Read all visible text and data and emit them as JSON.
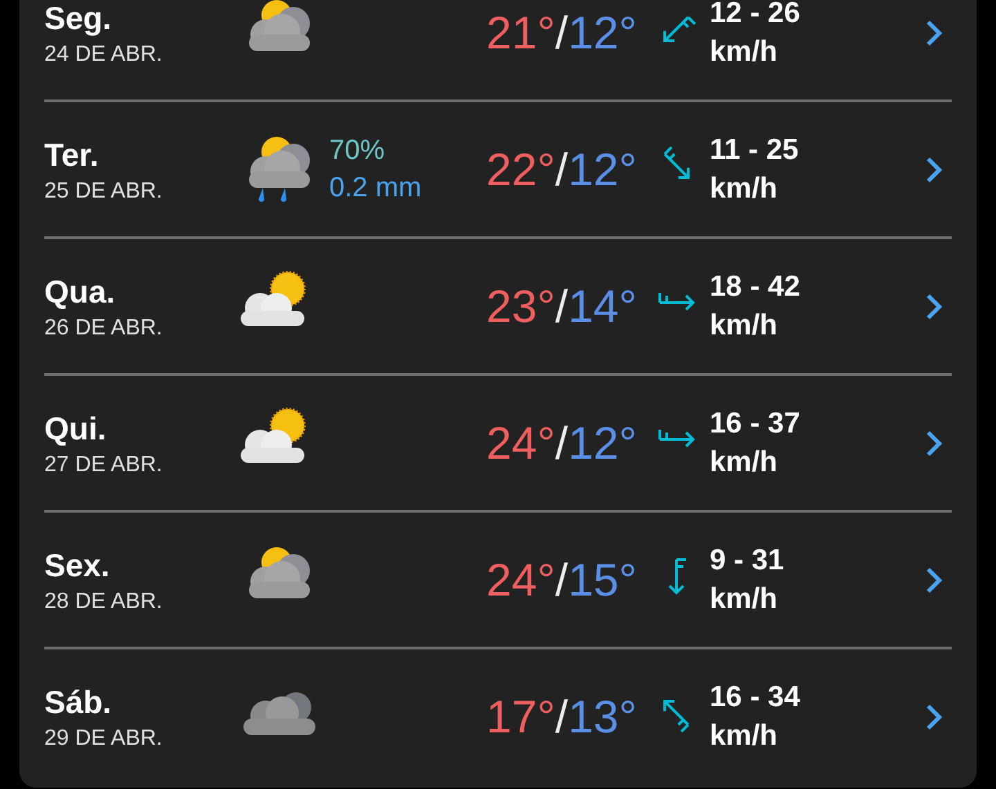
{
  "days": [
    {
      "day": "Seg.",
      "date": "24 DE ABR.",
      "kind": "partly_cloudy_grey",
      "high": "21°",
      "separator": "/",
      "low": "12°",
      "wind": {
        "kind": "sw",
        "speed": "12 - 26",
        "unit": "km/h"
      }
    },
    {
      "day": "Ter.",
      "date": "25 DE ABR.",
      "kind": "rain",
      "rain_chance": "70%",
      "rain_amount": "0.2 mm",
      "high": "22°",
      "separator": "/",
      "low": "12°",
      "wind": {
        "kind": "se",
        "speed": "11 - 25",
        "unit": "km/h"
      }
    },
    {
      "day": "Qua.",
      "date": "26 DE ABR.",
      "kind": "partly_cloudy",
      "high": "23°",
      "separator": "/",
      "low": "14°",
      "wind": {
        "kind": "e",
        "speed": "18 - 42",
        "unit": "km/h"
      }
    },
    {
      "day": "Qui.",
      "date": "27 DE ABR.",
      "kind": "partly_cloudy",
      "high": "24°",
      "separator": "/",
      "low": "12°",
      "wind": {
        "kind": "e",
        "speed": "16 - 37",
        "unit": "km/h"
      }
    },
    {
      "day": "Sex.",
      "date": "28 DE ABR.",
      "kind": "partly_cloudy_grey",
      "high": "24°",
      "separator": "/",
      "low": "15°",
      "wind": {
        "kind": "s",
        "speed": "9 - 31",
        "unit": "km/h"
      }
    },
    {
      "day": "Sáb.",
      "date": "29 DE ABR.",
      "kind": "cloudy",
      "high": "17°",
      "separator": "/",
      "low": "13°",
      "wind": {
        "kind": "nw",
        "speed": "16 - 34",
        "unit": "km/h"
      }
    }
  ]
}
